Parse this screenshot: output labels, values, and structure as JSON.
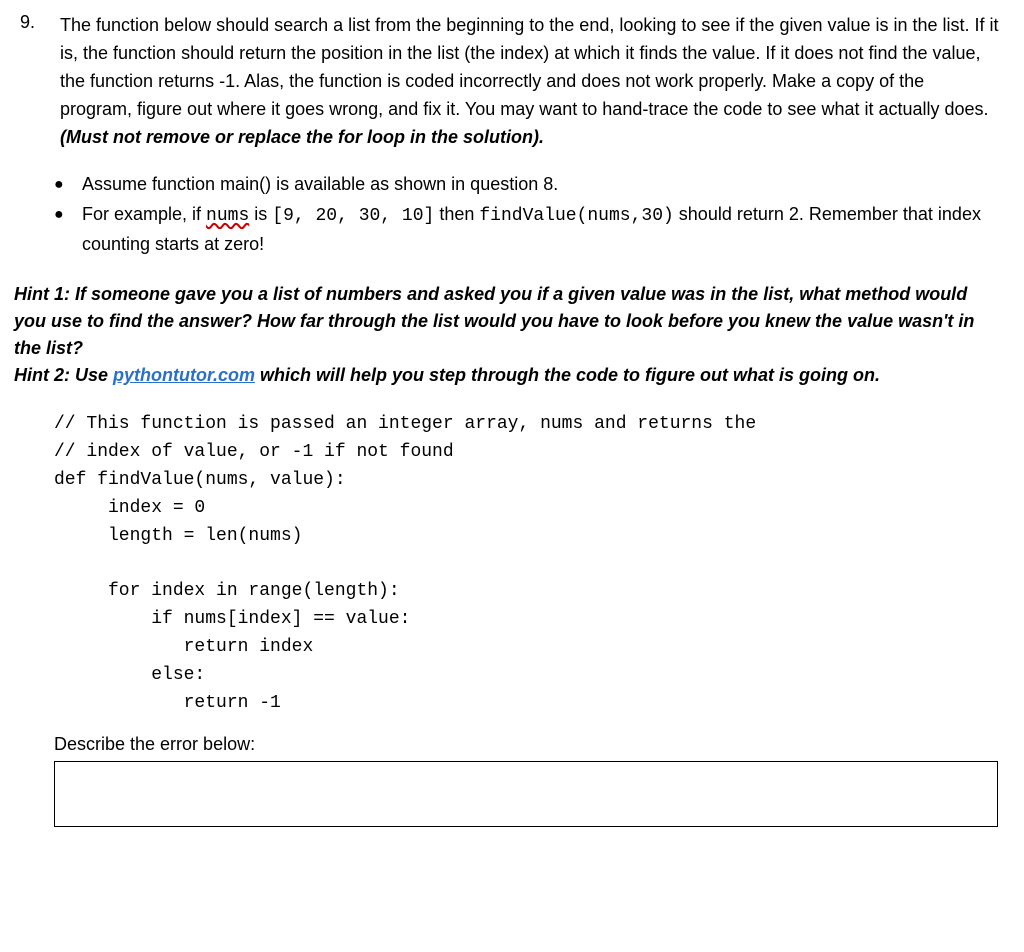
{
  "question": {
    "number": "9.",
    "prompt_main": "The function below should search a list from the beginning to the end, looking to see if the given value is in the list. If it is, the function should return the position in the list (the index) at which it finds the value. If it does not find the value, the function returns -1. Alas, the function is coded incorrectly and does not work properly. Make a copy of the program, figure out where it goes wrong, and fix it. You may want to hand-trace the code to see what it actually does. ",
    "prompt_constraint": "(Must not remove or replace the for loop in the solution)."
  },
  "bullets": {
    "b1": "Assume function main() is available as shown in question 8.",
    "b2_pre": "For example, if ",
    "b2_nums_word": "nums",
    "b2_mid1": " is ",
    "b2_list": "[9, 20, 30, 10]",
    "b2_mid2": " then ",
    "b2_call": "findValue(nums,30)",
    "b2_mid3": " should return 2.  Remember that index counting starts at zero!"
  },
  "hints": {
    "h1": "Hint 1: If someone gave you a list of numbers and asked you if a given value was in the list, what method would you use to find the answer? How far through the list would you have to look before you knew the value wasn't in the list?",
    "h2_pre": "Hint 2: Use ",
    "h2_link": "pythontutor.com",
    "h2_post": " which will help you step through the code to figure out what is going on."
  },
  "code": {
    "l1": "// This function is passed an integer array, nums and returns the",
    "l2": "// index of value, or -1 if not found",
    "l3": "def findValue(nums, value):",
    "l4": "     index = 0",
    "l5": "     length = len(nums)",
    "l6": "",
    "l7": "     for index in range(length):",
    "l8": "         if nums[index] == value:",
    "l9": "            return index",
    "l10": "         else:",
    "l11": "            return -1"
  },
  "describe_label": "Describe the error below:"
}
